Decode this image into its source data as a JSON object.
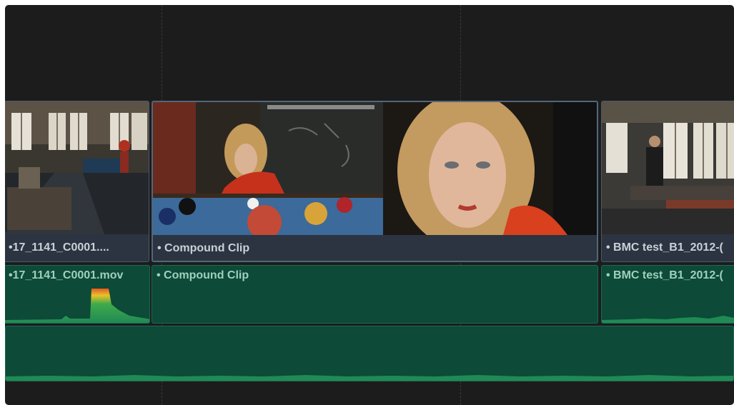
{
  "timeline": {
    "video_track": {
      "clips": [
        {
          "label": "•17_1141_C0001...."
        },
        {
          "label": "• Compound Clip"
        },
        {
          "label": "• BMC test_B1_2012-("
        }
      ]
    },
    "audio_track_1": {
      "clips": [
        {
          "label": "•17_1141_C0001.mov"
        },
        {
          "label": "• Compound Clip"
        },
        {
          "label": "• BMC test_B1_2012-("
        }
      ]
    },
    "audio_track_2": {
      "label": ""
    }
  },
  "colors": {
    "background": "#1c1c1d",
    "video_clip": "#2b3440",
    "audio_clip": "#0d4a38",
    "waveform": "#1f8a55",
    "peak": "#e8c22a"
  }
}
